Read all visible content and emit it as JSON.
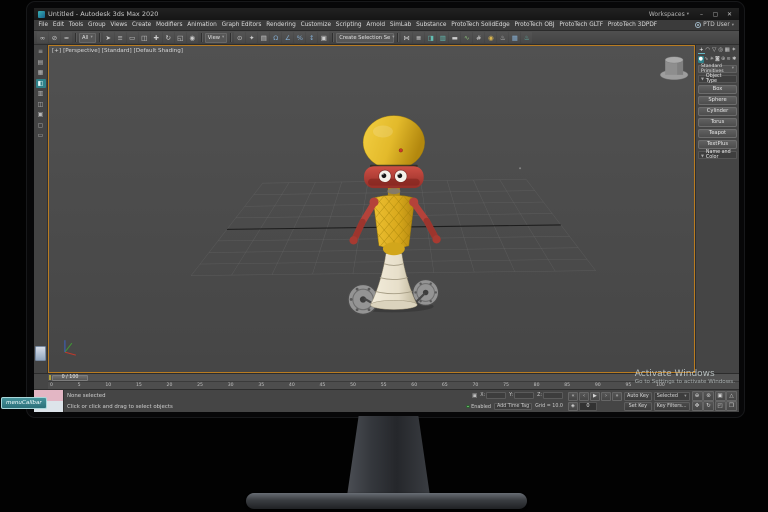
{
  "colors": {
    "viewport_border": "#b97c21",
    "highlight_teal": "#2f8189",
    "robot_head": "#e3ba2b",
    "robot_face": "#b4423a",
    "robot_skirt": "#e7dfca",
    "robot_wheel": "#949494",
    "watermark_text": "#d2dcdc",
    "tooltip_bg": "#2c7079"
  },
  "window": {
    "title": "Untitled - Autodesk 3ds Max 2020",
    "workspaces_label": "Workspaces",
    "minimize_glyph": "–",
    "maximize_glyph": "▢",
    "close_glyph": "✕"
  },
  "menubar": {
    "user_label": "PTD User",
    "items": [
      {
        "name": "menu-file",
        "label": "File"
      },
      {
        "name": "menu-edit",
        "label": "Edit"
      },
      {
        "name": "menu-tools",
        "label": "Tools"
      },
      {
        "name": "menu-group",
        "label": "Group"
      },
      {
        "name": "menu-views",
        "label": "Views"
      },
      {
        "name": "menu-create",
        "label": "Create"
      },
      {
        "name": "menu-modifiers",
        "label": "Modifiers"
      },
      {
        "name": "menu-animation",
        "label": "Animation"
      },
      {
        "name": "menu-graph-editors",
        "label": "Graph Editors"
      },
      {
        "name": "menu-rendering",
        "label": "Rendering"
      },
      {
        "name": "menu-customize",
        "label": "Customize"
      },
      {
        "name": "menu-scripting",
        "label": "Scripting"
      },
      {
        "name": "menu-arnold",
        "label": "Arnold"
      },
      {
        "name": "menu-simlab",
        "label": "SimLab"
      },
      {
        "name": "menu-substance",
        "label": "Substance"
      },
      {
        "name": "menu-prototech-solidedge",
        "label": "ProtoTech SolidEdge"
      },
      {
        "name": "menu-prototech-obj",
        "label": "ProtoTech OBJ"
      },
      {
        "name": "menu-prototech-gltf",
        "label": "ProtoTech GLTF"
      },
      {
        "name": "menu-prototech-3dpdf",
        "label": "ProtoTech 3DPDF"
      }
    ]
  },
  "toolbar": {
    "filter_label": "All",
    "coord_label": "View",
    "named_sets_label": "Create Selection Se",
    "icons_a": [
      {
        "name": "select-and-link-icon",
        "glyph": "∞"
      },
      {
        "name": "unlink-selection-icon",
        "glyph": "⊘"
      },
      {
        "name": "bind-to-space-warp-icon",
        "glyph": "≈"
      }
    ],
    "icons_b": [
      {
        "name": "select-object-icon",
        "glyph": "➤"
      },
      {
        "name": "select-by-name-icon",
        "glyph": "≡"
      },
      {
        "name": "selection-region-icon",
        "glyph": "▭"
      },
      {
        "name": "window-crossing-icon",
        "glyph": "◫"
      },
      {
        "name": "select-and-move-icon",
        "glyph": "✚"
      },
      {
        "name": "select-and-rotate-icon",
        "glyph": "↻"
      },
      {
        "name": "select-and-scale-icon",
        "glyph": "◱"
      },
      {
        "name": "select-and-place-icon",
        "glyph": "◉"
      }
    ],
    "icons_c": [
      {
        "name": "use-pivot-center-icon",
        "glyph": "⊙"
      },
      {
        "name": "select-and-manipulate-icon",
        "glyph": "✦"
      },
      {
        "name": "keyboard-override-icon",
        "glyph": "▤"
      },
      {
        "name": "snaps-toggle-icon",
        "glyph": "Ω",
        "cls": "c-blue"
      },
      {
        "name": "angle-snap-icon",
        "glyph": "∠",
        "cls": "c-blue"
      },
      {
        "name": "percent-snap-icon",
        "glyph": "%",
        "cls": "c-blue"
      },
      {
        "name": "spinner-snap-icon",
        "glyph": "↕",
        "cls": "c-blue"
      },
      {
        "name": "edit-named-selections-icon",
        "glyph": "▣"
      }
    ],
    "icons_d": [
      {
        "name": "mirror-icon",
        "glyph": "⋈"
      },
      {
        "name": "align-icon",
        "glyph": "≣"
      },
      {
        "name": "toggle-scene-explorer-icon",
        "glyph": "◨",
        "cls": "c-teal"
      },
      {
        "name": "toggle-layer-explorer-icon",
        "glyph": "▥",
        "cls": "c-teal"
      },
      {
        "name": "toggle-ribbon-icon",
        "glyph": "▬"
      },
      {
        "name": "curve-editor-icon",
        "glyph": "∿",
        "cls": "c-green"
      },
      {
        "name": "schematic-view-icon",
        "glyph": "#"
      },
      {
        "name": "material-editor-icon",
        "glyph": "◉",
        "cls": "c-gold"
      },
      {
        "name": "render-setup-icon",
        "glyph": "♨"
      },
      {
        "name": "rendered-frame-icon",
        "glyph": "▦",
        "cls": "c-blue"
      },
      {
        "name": "render-production-icon",
        "glyph": "♨",
        "cls": "c-teal"
      }
    ]
  },
  "left_toolbar": {
    "items": [
      {
        "name": "toolbar-grip-icon",
        "glyph": "≡"
      },
      {
        "name": "layout-tab-icon",
        "glyph": "▤"
      },
      {
        "name": "layout-tab-icon",
        "glyph": "▦"
      },
      {
        "name": "layout-tab-icon",
        "glyph": "◧",
        "cls": "active"
      },
      {
        "name": "layout-tab-icon",
        "glyph": "▥"
      },
      {
        "name": "layout-tab-icon",
        "glyph": "◫"
      },
      {
        "name": "layout-tab-icon",
        "glyph": "▣"
      },
      {
        "name": "layout-tab-icon",
        "glyph": "▢"
      },
      {
        "name": "layout-tab-icon",
        "glyph": "▭"
      }
    ]
  },
  "viewport": {
    "menus": [
      {
        "name": "viewport-general-menu",
        "label": "[+]"
      },
      {
        "name": "viewport-pov-menu",
        "label": "[Perspective]"
      },
      {
        "name": "viewport-style-menu",
        "label": "[Standard]"
      },
      {
        "name": "viewport-shading-menu",
        "label": "[Default Shading]"
      }
    ]
  },
  "cpanel": {
    "tabs": [
      {
        "name": "create-tab-icon",
        "glyph": "+",
        "cls": "active"
      },
      {
        "name": "modify-tab-icon",
        "glyph": "◠"
      },
      {
        "name": "hierarchy-tab-icon",
        "glyph": "▽"
      },
      {
        "name": "motion-tab-icon",
        "glyph": "◎"
      },
      {
        "name": "display-tab-icon",
        "glyph": "▦"
      },
      {
        "name": "utilities-tab-icon",
        "glyph": "✶"
      }
    ],
    "categories": [
      {
        "name": "geometry-category-icon",
        "glyph": "●",
        "cls": "active"
      },
      {
        "name": "shapes-category-icon",
        "glyph": "∿"
      },
      {
        "name": "lights-category-icon",
        "glyph": "☀"
      },
      {
        "name": "cameras-category-icon",
        "glyph": "◙"
      },
      {
        "name": "helpers-category-icon",
        "glyph": "⊕"
      },
      {
        "name": "space-warps-category-icon",
        "glyph": "≋"
      },
      {
        "name": "systems-category-icon",
        "glyph": "✱"
      }
    ],
    "dropdown_label": "Standard Primitives",
    "rollout_object_type": "Object Type",
    "buttons": [
      {
        "name": "box-button",
        "label": "Box"
      },
      {
        "name": "sphere-button",
        "label": "Sphere"
      },
      {
        "name": "cylinder-button",
        "label": "Cylinder"
      },
      {
        "name": "torus-button",
        "label": "Torus"
      },
      {
        "name": "teapot-button",
        "label": "Teapot"
      },
      {
        "name": "textplus-button",
        "label": "TextPlus"
      }
    ],
    "rollout_name_color": "Name and Color"
  },
  "timeline": {
    "slider_label": "0 / 100",
    "ticks": [
      "0",
      "5",
      "10",
      "15",
      "20",
      "25",
      "30",
      "35",
      "40",
      "45",
      "50",
      "55",
      "60",
      "65",
      "70",
      "75",
      "80",
      "85",
      "90",
      "95",
      "100"
    ]
  },
  "status": {
    "status_line": "None selected",
    "prompt_line": "Click or click and drag to select objects",
    "lock_glyph": "▣",
    "x_label": "X:",
    "y_label": "Y:",
    "z_label": "Z:",
    "enabled_label": "Enabled",
    "time_tag_label": "Add Time Tag",
    "grid_label": "Grid = 10.0",
    "transport": [
      {
        "name": "go-to-start-button",
        "glyph": "«"
      },
      {
        "name": "previous-frame-button",
        "glyph": "‹"
      },
      {
        "name": "play-button",
        "glyph": "▶"
      },
      {
        "name": "next-frame-button",
        "glyph": "›"
      },
      {
        "name": "go-to-end-button",
        "glyph": "»"
      }
    ],
    "key_mode_glyph": "◈",
    "frame_value": "0",
    "auto_key_label": "Auto Key",
    "set_key_label": "Set Key",
    "selected_label": "Selected",
    "key_filters_label": "Key Filters...",
    "nav": [
      {
        "name": "zoom-icon",
        "glyph": "⊕"
      },
      {
        "name": "zoom-all-icon",
        "glyph": "⊛"
      },
      {
        "name": "zoom-extents-icon",
        "glyph": "▣"
      },
      {
        "name": "fov-icon",
        "glyph": "△"
      },
      {
        "name": "pan-icon",
        "glyph": "✥"
      },
      {
        "name": "orbit-icon",
        "glyph": "↻"
      },
      {
        "name": "zoom-region-icon",
        "glyph": "◰"
      },
      {
        "name": "maximize-viewport-icon",
        "glyph": "❒"
      }
    ]
  },
  "watermark": {
    "line1": "Activate Windows",
    "line2": "Go to Settings to activate Windows."
  },
  "tooltip": {
    "text": "menuCallbar"
  }
}
